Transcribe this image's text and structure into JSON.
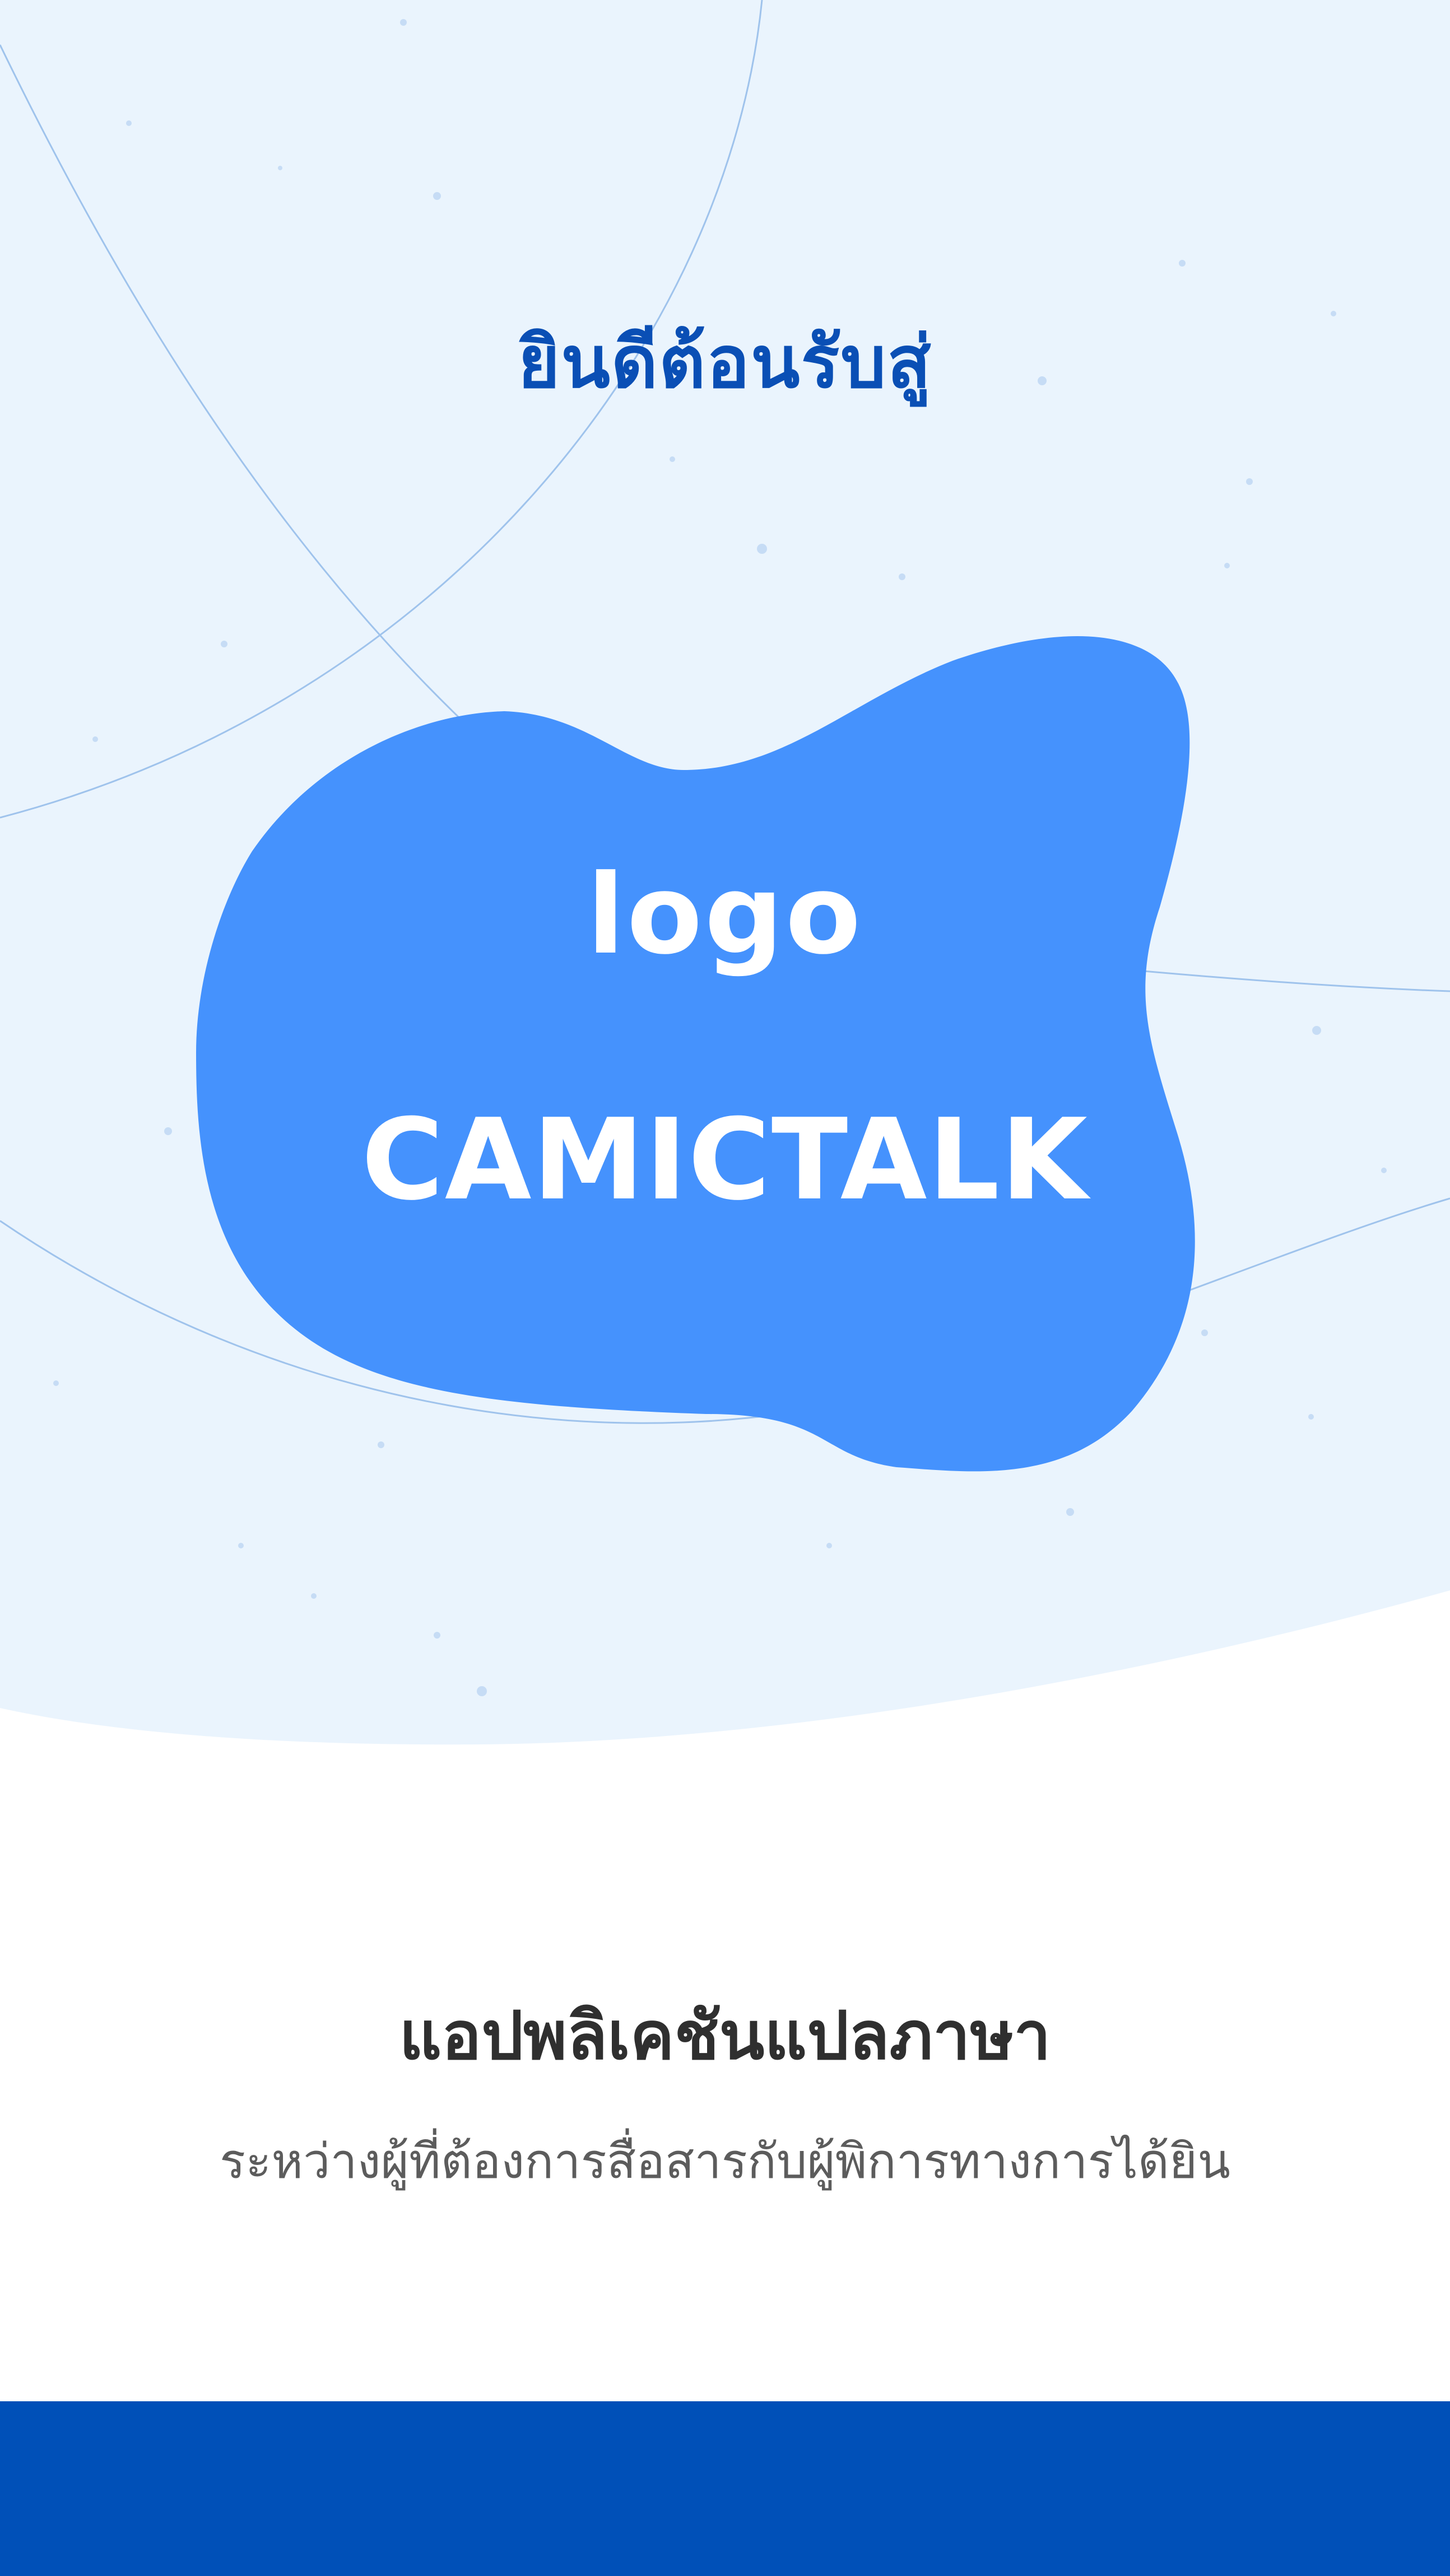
{
  "welcome": {
    "title": "ยินดีต้อนรับสู่"
  },
  "logo": {
    "label": "logo",
    "name": "CAMICTALK"
  },
  "intro": {
    "title": "แอปพลิเคชันแปลภาษา",
    "subtitle": "ระหว่างผู้ที่ต้องการสื่อสารกับผู้พิการทางการได้ยิน"
  },
  "colors": {
    "background": "#eaf4fd",
    "accent": "#0a4fb5",
    "blob": "#4592fd",
    "bottom_bar": "#0050b8",
    "title_text": "#2f2f2f",
    "subtitle_text": "#5c5c5c"
  }
}
